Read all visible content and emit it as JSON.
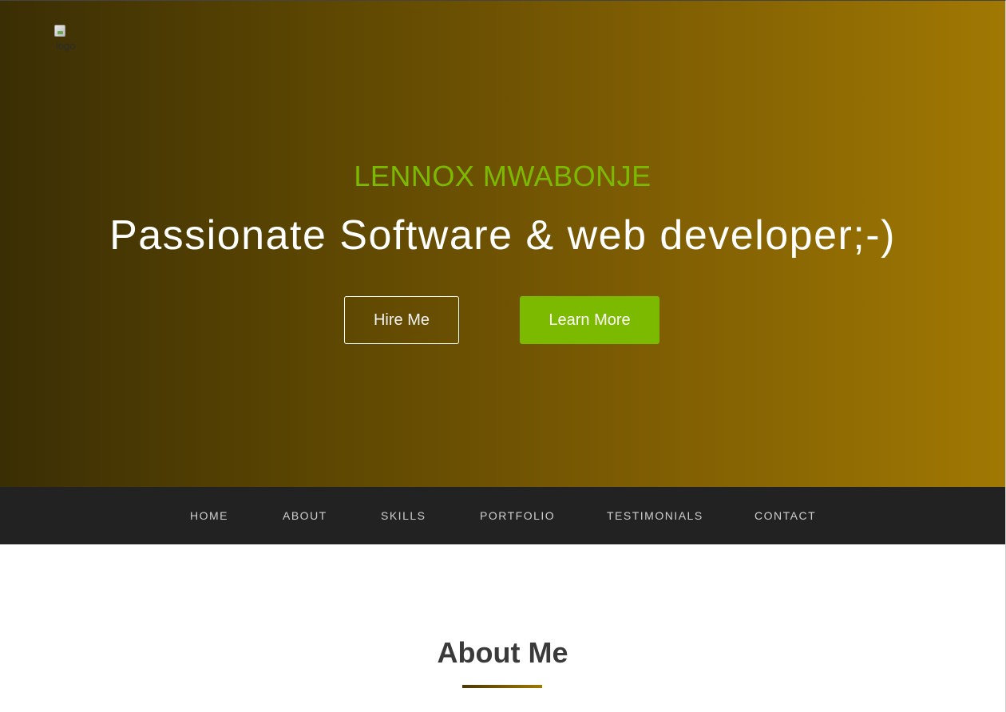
{
  "header": {
    "logo_alt": "logo",
    "name": "LENNOX MWABONJE",
    "tagline": "Passionate Software & web developer;-)",
    "buttons": {
      "hire_label": "Hire Me",
      "learn_label": "Learn More"
    }
  },
  "nav": {
    "items": [
      "HOME",
      "ABOUT",
      "SKILLS",
      "PORTFOLIO",
      "TESTIMONIALS",
      "CONTACT"
    ]
  },
  "about": {
    "title": "About Me"
  },
  "colors": {
    "accent": "#7cba00",
    "hero_gradient_start": "#3a2e04",
    "hero_gradient_end": "#a07803",
    "nav_background": "#222222"
  },
  "icons": {
    "logo": "broken-image-icon"
  }
}
